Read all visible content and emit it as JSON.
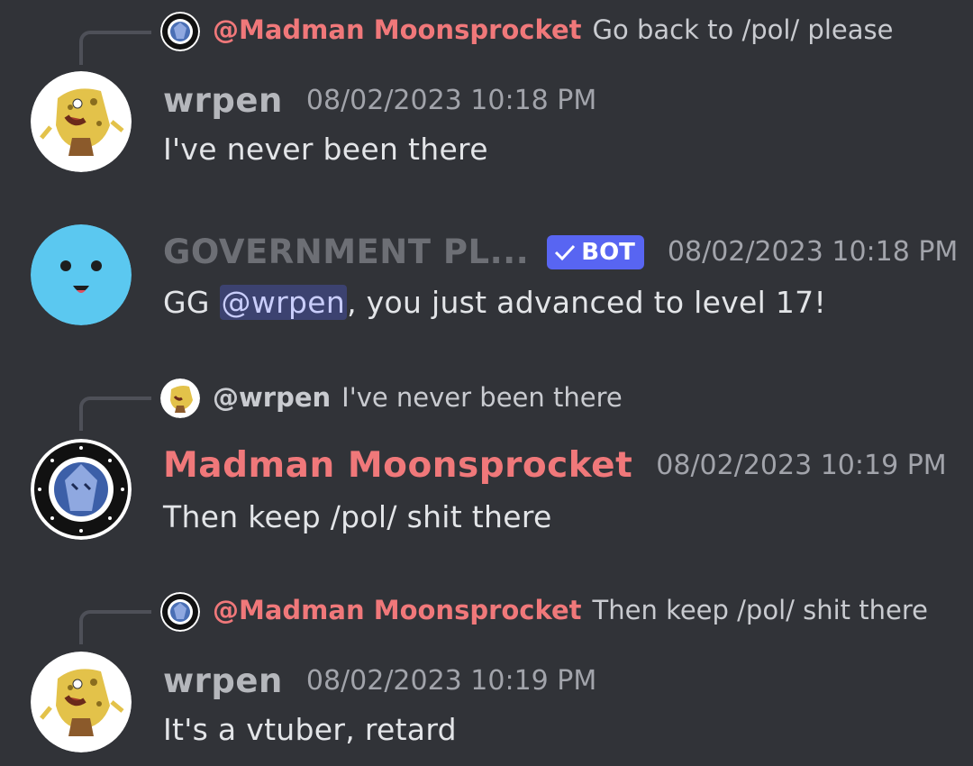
{
  "colors": {
    "background": "#313338",
    "mention_author": "#f0787a",
    "username_default": "#b5b7bc",
    "bot_badge": "#5865f2",
    "mention_bg": "#3c4270"
  },
  "messages": [
    {
      "reply": {
        "author": "@Madman Moonsprocket",
        "text": "Go back to /pol/ please"
      },
      "username": "wrpen",
      "timestamp": "08/02/2023 10:18 PM",
      "text": "I've never been there"
    },
    {
      "username": "GOVERNMENT PL...",
      "bot_tag": "BOT",
      "timestamp": "08/02/2023 10:18 PM",
      "text_prefix": "GG ",
      "mention": "@wrpen",
      "text_suffix": ", you just advanced to level 17!"
    },
    {
      "reply": {
        "author": "@wrpen",
        "text": "I've never been there"
      },
      "username": "Madman Moonsprocket",
      "timestamp": "08/02/2023 10:19 PM",
      "text": "Then keep /pol/ shit there"
    },
    {
      "reply": {
        "author": "@Madman Moonsprocket",
        "text": "Then keep /pol/ shit there"
      },
      "username": "wrpen",
      "timestamp": "08/02/2023 10:19 PM",
      "text": "It's a vtuber, retard"
    }
  ]
}
